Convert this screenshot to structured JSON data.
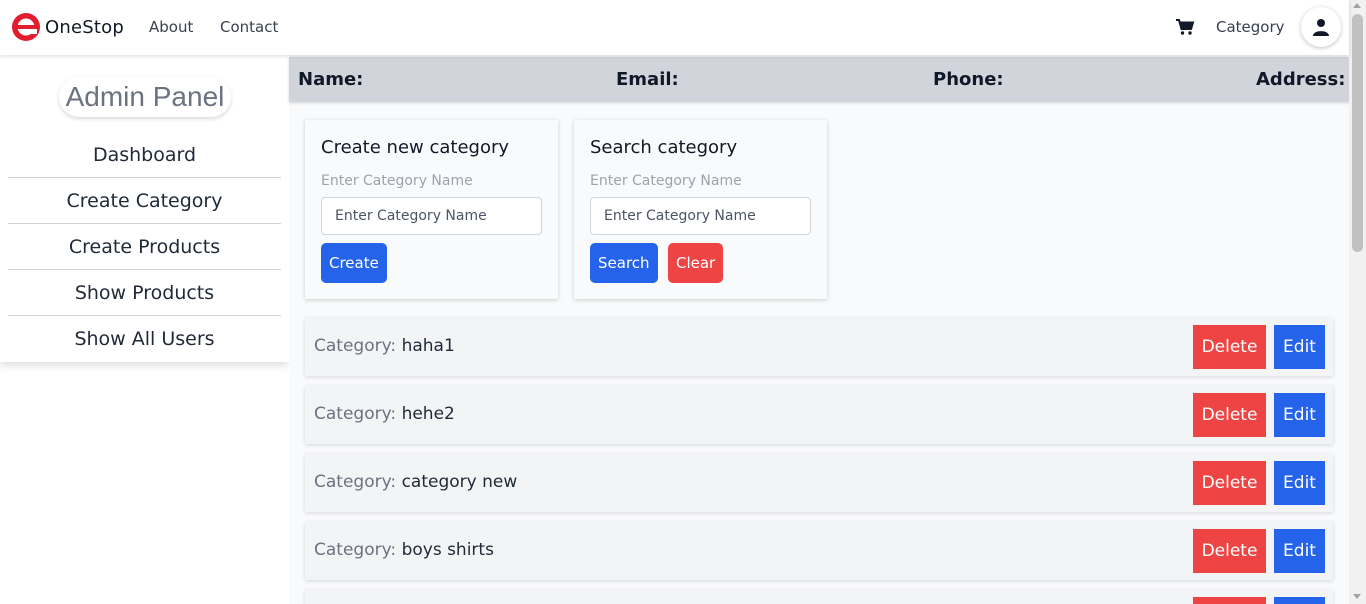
{
  "navbar": {
    "brand": "OneStop",
    "links": [
      "About",
      "Contact"
    ],
    "category": "Category"
  },
  "sidebar": {
    "title": "Admin Panel",
    "items": [
      "Dashboard",
      "Create Category",
      "Create Products",
      "Show Products",
      "Show All Users"
    ]
  },
  "user_bar": {
    "name": "Name:",
    "email": "Email:",
    "phone": "Phone:",
    "address": "Address:"
  },
  "create_card": {
    "title": "Create new category",
    "label": "Enter Category Name",
    "placeholder": "Enter Category Name",
    "button": "Create"
  },
  "search_card": {
    "title": "Search category",
    "label": "Enter Category Name",
    "placeholder": "Enter Category Name",
    "search_button": "Search",
    "clear_button": "Clear"
  },
  "categories": {
    "prefix": "Category:",
    "delete_label": "Delete",
    "edit_label": "Edit",
    "items": [
      "haha1",
      "hehe2",
      "category new",
      "boys shirts"
    ]
  },
  "colors": {
    "primary": "#2563eb",
    "danger": "#ef4444",
    "logo": "#e11d2e"
  }
}
